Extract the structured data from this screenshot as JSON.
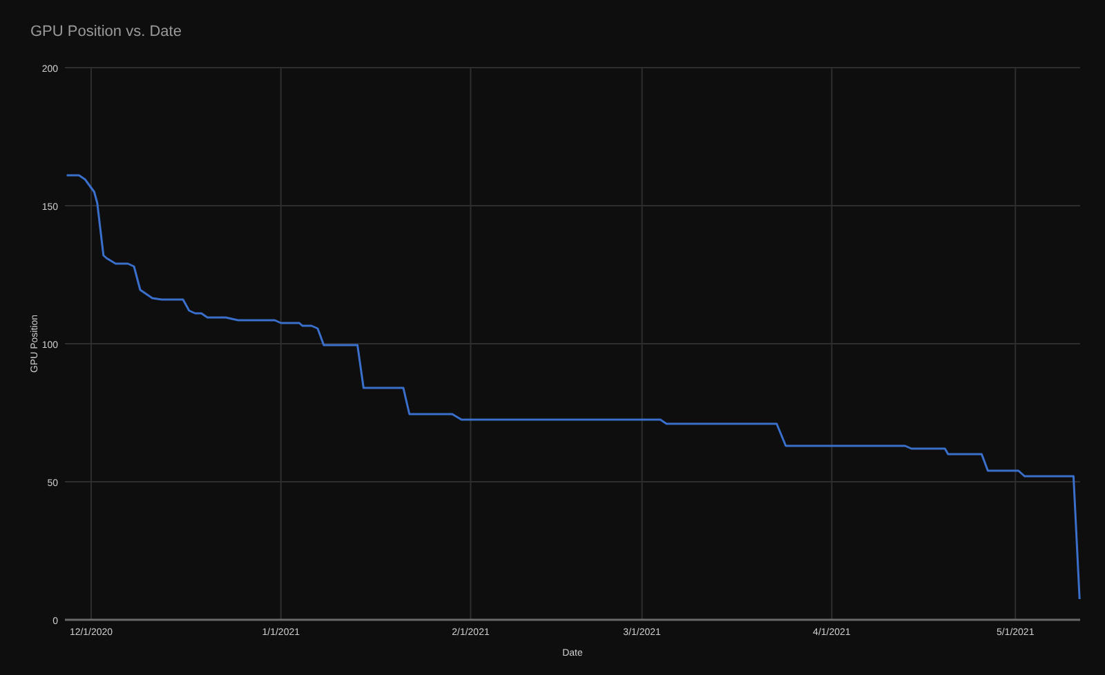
{
  "title": "GPU Position vs. Date",
  "chart_data": {
    "type": "line",
    "grid": true,
    "xlabel": "Date",
    "ylabel": "GPU Position",
    "xlim": [
      "2020-11-26T17:00",
      "2021-05-11T14:00"
    ],
    "ylim": [
      0,
      200
    ],
    "xticks": [
      {
        "value": "2020-12-01",
        "label": "12/1/2020"
      },
      {
        "value": "2021-01-01",
        "label": "1/1/2021"
      },
      {
        "value": "2021-02-01",
        "label": "2/1/2021"
      },
      {
        "value": "2021-03-01",
        "label": "3/1/2021"
      },
      {
        "value": "2021-04-01",
        "label": "4/1/2021"
      },
      {
        "value": "2021-05-01",
        "label": "5/1/2021"
      }
    ],
    "yticks": [
      0,
      50,
      100,
      150,
      200
    ],
    "x": [
      "2020-11-27",
      "2020-11-29",
      "2020-11-30",
      "2020-11-30T12:00",
      "2020-12-01T12:00",
      "2020-12-02",
      "2020-12-03",
      "2020-12-03T12:00",
      "2020-12-05",
      "2020-12-07",
      "2020-12-08",
      "2020-12-09",
      "2020-12-10",
      "2020-12-11",
      "2020-12-12T12:00",
      "2020-12-16",
      "2020-12-17",
      "2020-12-18",
      "2020-12-19",
      "2020-12-20",
      "2020-12-23",
      "2020-12-25",
      "2020-12-31",
      "2021-01-01",
      "2021-01-04",
      "2021-01-04T12:00",
      "2021-01-06",
      "2021-01-07",
      "2021-01-08",
      "2021-01-13T12:00",
      "2021-01-14T12:00",
      "2021-01-21",
      "2021-01-22",
      "2021-01-29",
      "2021-01-30T12:00",
      "2021-03-04",
      "2021-03-05",
      "2021-03-23",
      "2021-03-24T12:00",
      "2021-04-13",
      "2021-04-14",
      "2021-04-19T12:00",
      "2021-04-20",
      "2021-04-25T12:00",
      "2021-04-26T12:00",
      "2021-05-01T12:00",
      "2021-05-02T12:00",
      "2021-05-10T12:00",
      "2021-05-11T12:00"
    ],
    "series": [
      {
        "color": "#3a70cc",
        "values": [
          161,
          161,
          159.5,
          158,
          155,
          151,
          132,
          131,
          129,
          129,
          128,
          119.5,
          118,
          116.5,
          116,
          116,
          112,
          111,
          111,
          109.5,
          109.5,
          108.5,
          108.5,
          107.5,
          107.5,
          106.5,
          106.5,
          105.5,
          99.5,
          99.5,
          84,
          84,
          74.5,
          74.5,
          72.5,
          72.5,
          71,
          71,
          63,
          63,
          62,
          62,
          60,
          60,
          54,
          54,
          52,
          52,
          7.5
        ]
      }
    ]
  }
}
